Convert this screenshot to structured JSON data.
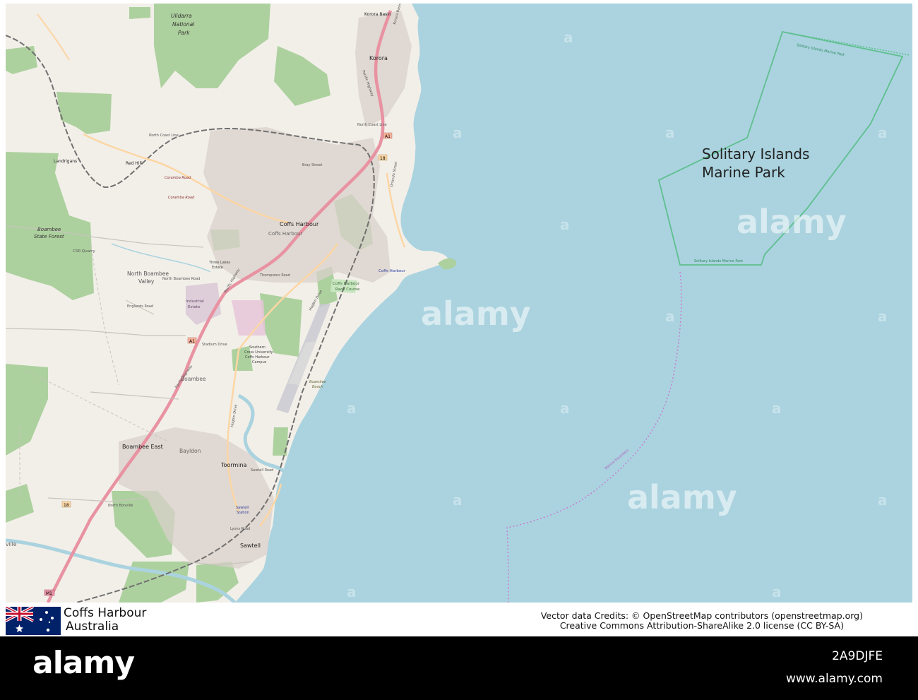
{
  "map": {
    "title": "Coffs Harbour",
    "country": "Australia",
    "marine_park_label_line1": "Solitary Islands",
    "marine_park_label_line2": "Marine Park",
    "colors": {
      "sea": "#aad3df",
      "land": "#f2efe9",
      "farmland": "#eef0d5",
      "forest": "#add19e",
      "urban": "#d9d0c9",
      "motorway": "#e892a2",
      "trunk": "#f9b29c",
      "primary": "#fcd6a4",
      "railway": "#707070",
      "park_boundary": "#5fbf8f",
      "maritime_boundary": "#c77dd1"
    },
    "places": {
      "korora": "Korora",
      "korora_basin": "Korora Basin",
      "coffs_harbour": "Coffs Harbour",
      "coffs_harbour_small": "Coffs Harbour",
      "coffs_harbour_port": "Coffs Harbour",
      "north_boambee": "North Boambee",
      "valley": "Valley",
      "boambee_state_forest_1": "Boambee",
      "boambee_state_forest_2": "State Forest",
      "ulidarra_1": "Ulidarra",
      "ulidarra_2": "National",
      "ulidarra_3": "Park",
      "boambee": "Boambee",
      "boambee_east": "Boambee East",
      "bayldon": "Bayldon",
      "toormina": "Toormina",
      "sawtell": "Sawtell",
      "red_hill": "Red Hill",
      "landrigans": "Landrigans",
      "race_course_1": "Coffs Harbour",
      "race_course_2": "Race Course",
      "industrial_1": "Industrial",
      "industrial_2": "Estate",
      "university_1": "Southern",
      "university_2": "Cross University",
      "university_3": "Coffs Harbour",
      "university_4": "Campus",
      "boambee_beach_1": "Boambee",
      "boambee_beach_2": "Beach",
      "csr_quarry": "CSR Quarry",
      "three_lakes_1": "Three Lakes",
      "three_lakes_2": "Estate",
      "sawtell_station_1": "Sawtell",
      "sawtell_station_2": "Station",
      "ville": "ville"
    },
    "roads": {
      "pacific_highway": "Pacific Highway",
      "coramba_road": "Coramba Road",
      "north_coast_line": "North Coast Line",
      "hogbin_drive": "Hogbin Drive",
      "stadium_drive": "Stadium Drive",
      "bray_street": "Bray Street",
      "thompsons_road": "Thompsons Road",
      "north_boambee_road": "North Boambee Road",
      "englands_road": "Englands Road",
      "lyons_road": "Lyons Road",
      "sawtell_road": "Sawtell Road",
      "north_bonville": "North Bonville",
      "orlando_street": "Orlando Street",
      "korora_basin_road": "Korora Basin Road",
      "shield": {
        "a1_top": "A1",
        "a1_mid": "A1",
        "b18": "18",
        "m1": "M1",
        "b18_south": "18"
      }
    },
    "park_boundary_text": "Solitary Islands Marine Park",
    "maritime_text": "Marine boundary"
  },
  "credits": {
    "line1": "Vector data Credits: © OpenStreetMap contributors (openstreetmap.org)",
    "line2": "Creative Commons Attribution-ShareAlike 2.0 license (CC BY-SA)"
  },
  "stock": {
    "logo": "alamy",
    "image_id": "2A9DJFE",
    "url": "www.alamy.com",
    "watermark": "alamy"
  }
}
